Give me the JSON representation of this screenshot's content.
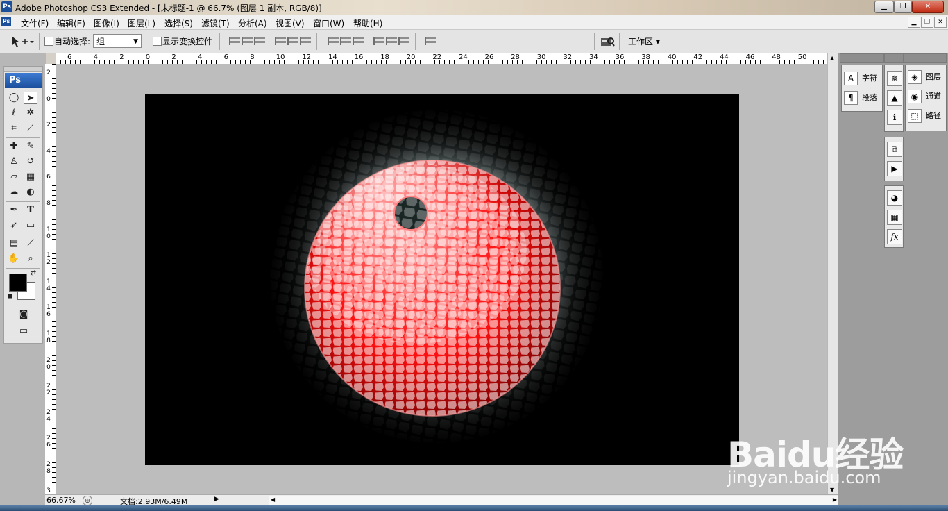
{
  "window": {
    "title": "Adobe Photoshop CS3 Extended - [未标题-1 @ 66.7% (图层 1 副本, RGB/8)]",
    "app_badge": "Ps",
    "buttons": {
      "minimize": "▁",
      "maximize": "❐",
      "close": "✕"
    }
  },
  "menu": {
    "items": [
      "文件(F)",
      "编辑(E)",
      "图像(I)",
      "图层(L)",
      "选择(S)",
      "滤镜(T)",
      "分析(A)",
      "视图(V)",
      "窗口(W)",
      "帮助(H)"
    ],
    "doc_buttons": {
      "minimize": "▁",
      "restore": "❐",
      "close": "✕"
    }
  },
  "options": {
    "auto_select_label": "自动选择:",
    "auto_select_value": "组",
    "show_transform_label": "显示变换控件",
    "workspace_label": "工作区 ▾"
  },
  "toolbox": {
    "badge": "Ps"
  },
  "rulers": {
    "horizontal": [
      "6",
      "4",
      "2",
      "0",
      "2",
      "4",
      "6",
      "8",
      "10",
      "12",
      "14",
      "16",
      "18",
      "20",
      "22",
      "24",
      "26",
      "28",
      "30",
      "32",
      "34",
      "36",
      "38",
      "40",
      "42",
      "44",
      "46",
      "48",
      "50"
    ],
    "vertical": [
      "2",
      "0",
      "2",
      "4",
      "6",
      "8",
      "1\n0",
      "1\n2",
      "1\n4",
      "1\n6",
      "1\n8",
      "2\n0",
      "2\n2",
      "2\n4",
      "2\n6",
      "2\n8",
      "3\n0",
      "3\n2"
    ]
  },
  "status": {
    "zoom": "66.67%",
    "doc_size": "文档:2.93M/6.49M"
  },
  "panels": {
    "character": "字符",
    "paragraph": "段落",
    "layers": "图层",
    "channels": "通道",
    "paths": "路径"
  },
  "watermark": {
    "brand": "Baidu经验",
    "url": "jingyan.baidu.com"
  },
  "colors": {
    "foreground": "#000000",
    "background": "#ffffff",
    "accent_red": "#ff2020"
  }
}
